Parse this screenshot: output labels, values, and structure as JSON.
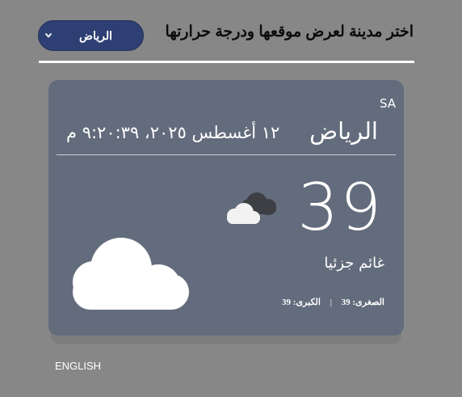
{
  "header": {
    "title": "اختر مدينة لعرض موقعها ودرجة حرارتها"
  },
  "city_select": {
    "selected": "الرياض",
    "icon": "chevron-down-icon"
  },
  "weather": {
    "country": "SA",
    "city": "الرياض",
    "datetime": "١٢ أغسطس ٢٠٢٥، ٩:٢٠:٣٩ م",
    "temperature": "39",
    "condition_icon": "partly-cloudy-icon",
    "main_icon": "cloud-icon",
    "description": "غائم جزئيا",
    "min_label": "الصغرى:",
    "min_value": "39",
    "separator": "|",
    "max_label": "الكبرى:",
    "max_value": "39"
  },
  "footer": {
    "language_link": "ENGLISH"
  },
  "colors": {
    "page_background": "#878787",
    "card_background": "#636c7c",
    "select_background": "#2e3f73"
  }
}
